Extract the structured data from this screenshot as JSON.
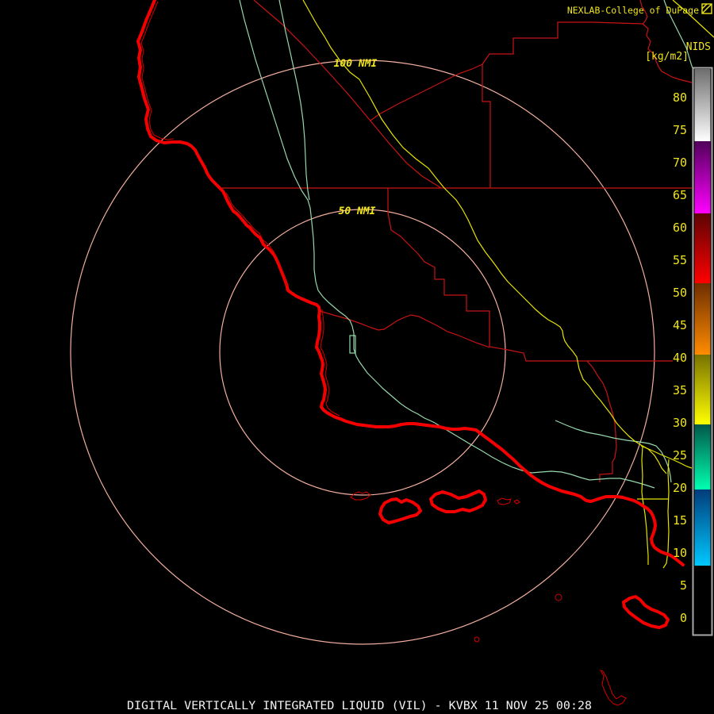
{
  "header": {
    "brand": "NEXLAB-College of DuPage",
    "logo_icon": "cod-flag-icon",
    "product": "NIDS",
    "units": "[kg/m2]"
  },
  "rings": {
    "outer_label": "100 NMI",
    "inner_label": "50 NMI"
  },
  "colorbar": {
    "ticks": [
      "80",
      "75",
      "70",
      "65",
      "60",
      "55",
      "50",
      "45",
      "40",
      "35",
      "30",
      "25",
      "20",
      "15",
      "10",
      "5",
      "0"
    ],
    "segments_top_to_bottom": [
      "gray",
      "purple",
      "red",
      "orange",
      "yellow",
      "teal",
      "blue",
      "black"
    ]
  },
  "footer": {
    "title": "DIGITAL VERTICALLY INTEGRATED LIQUID (VIL) - KVBX 11 NOV 25 00:28"
  },
  "colors": {
    "background": "#000000",
    "coastline": "#f50000",
    "county_lines": "#c81414",
    "range_rings": "#f2ae9e",
    "green_highways": "#96d8ac",
    "yellow_highways": "#e6e200",
    "label_yellow": "#f0e41c",
    "title_white": "#f2f2f2",
    "bar_border": "#a8a8a8"
  }
}
